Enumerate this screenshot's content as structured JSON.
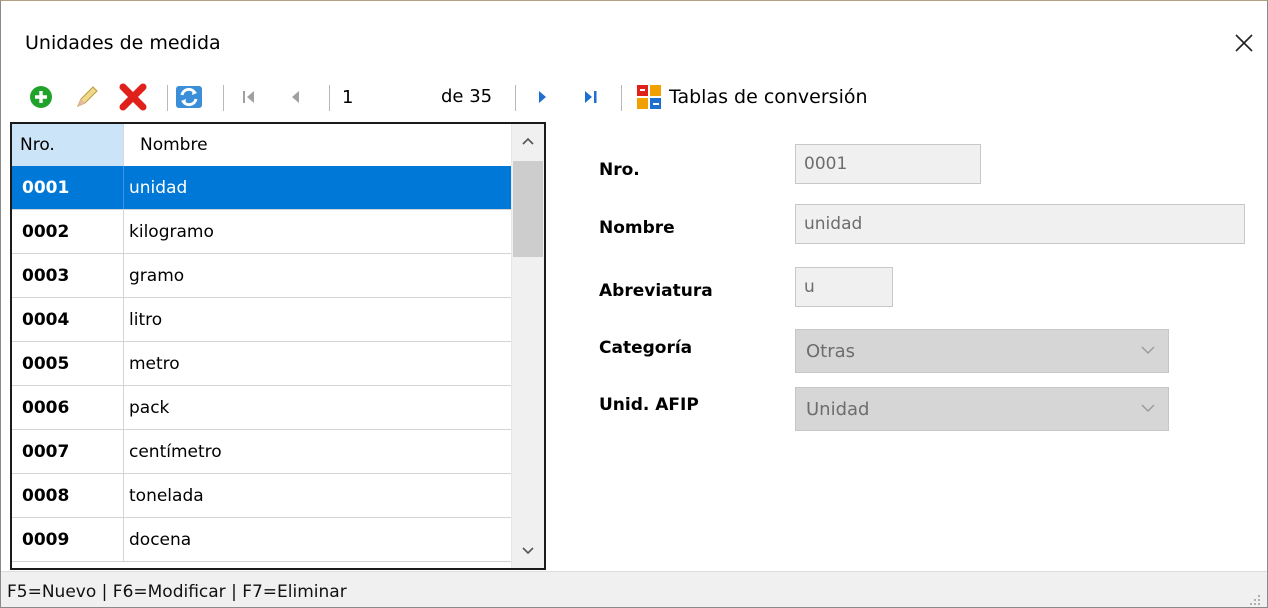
{
  "window": {
    "title": "Unidades de medida"
  },
  "toolbar": {
    "current_record": "1",
    "of_label": "de 35",
    "conversion_label": "Tablas de conversión"
  },
  "grid": {
    "columns": [
      "Nro.",
      "Nombre"
    ],
    "rows": [
      {
        "nro": "0001",
        "nombre": "unidad"
      },
      {
        "nro": "0002",
        "nombre": "kilogramo"
      },
      {
        "nro": "0003",
        "nombre": "gramo"
      },
      {
        "nro": "0004",
        "nombre": "litro"
      },
      {
        "nro": "0005",
        "nombre": "metro"
      },
      {
        "nro": "0006",
        "nombre": "pack"
      },
      {
        "nro": "0007",
        "nombre": "centímetro"
      },
      {
        "nro": "0008",
        "nombre": "tonelada"
      },
      {
        "nro": "0009",
        "nombre": "docena"
      }
    ]
  },
  "form": {
    "nro_label": "Nro.",
    "nro_value": "0001",
    "nombre_label": "Nombre",
    "nombre_value": "unidad",
    "abreviatura_label": "Abreviatura",
    "abreviatura_value": "u",
    "categoria_label": "Categoría",
    "categoria_value": "Otras",
    "afip_label": "Unid. AFIP",
    "afip_value": "Unidad"
  },
  "status": {
    "text": "F5=Nuevo | F6=Modificar | F7=Eliminar"
  },
  "icons": [
    "add-icon",
    "edit-icon",
    "delete-icon",
    "refresh-icon",
    "first-record-icon",
    "previous-record-icon",
    "next-record-icon",
    "last-record-icon",
    "conversion-table-icon",
    "close-icon"
  ],
  "colors": {
    "selection": "#0078d7",
    "header_highlight": "#cce4f7",
    "add": "#1fa32b",
    "delete": "#e0201b"
  }
}
